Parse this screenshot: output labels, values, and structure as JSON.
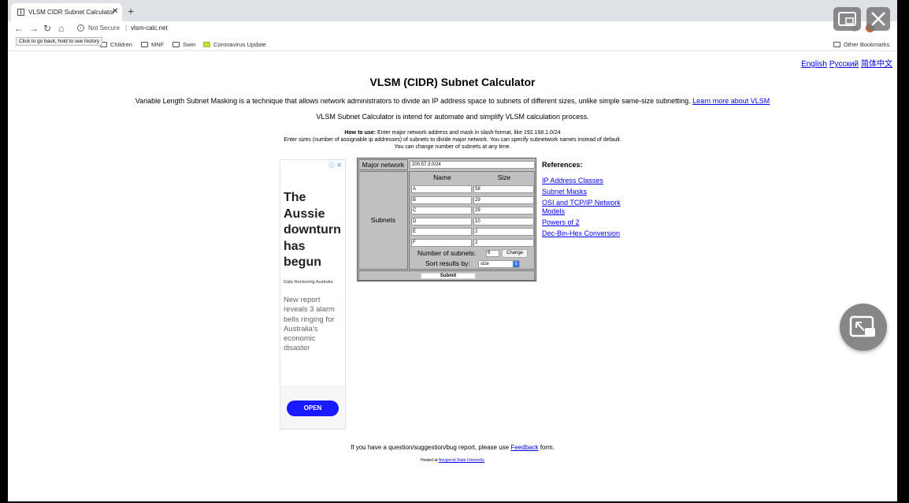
{
  "browser": {
    "tab_title": "VLSM CIDR Subnet Calculator",
    "close_tab": "✕",
    "new_tab": "+",
    "back": "←",
    "forward": "→",
    "reload": "↻",
    "home": "⌂",
    "security_label": "Not Secure",
    "url": "vlsm-calc.net",
    "tooltip": "Click to go back, hold to see history",
    "bookmarks": [
      "Children",
      "MNF",
      "Swin",
      "Coronavirus Update"
    ],
    "other_bookmarks": "Other Bookmarks"
  },
  "page": {
    "languages": [
      "English",
      "Русский",
      "简体中文"
    ],
    "title": "VLSM (CIDR) Subnet Calculator",
    "intro": "Variable Length Subnet Masking is a technique that allows network administrators to divide an IP address space to subnets of different sizes, unlike simple same-size subnetting.",
    "learn_more": "Learn more about VLSM",
    "intro2": "VLSM Subnet Calculator is intend for automate and simplify VLSM calculation process.",
    "how_to_label": "How to use:",
    "how_to_1": "Enter major network address and mask in slash-format, like 192.168.1.0/24",
    "how_to_2": "Enter sizes (number of assignable ip addresses) of subnets to divide major network. You can specify subnetwork names instead of default.",
    "how_to_3": "You can change number of subnets at any time."
  },
  "ad": {
    "choices_icon": "ⓘ ✕",
    "headline": "The Aussie downturn has begun",
    "source": "Daily Reckoning Australia",
    "body": "New report reveals 3 alarm bells ringing for Australia's economic disaster",
    "cta": "OPEN"
  },
  "calculator": {
    "major_network_label": "Major network",
    "major_network_value": "200.57.3.0/24",
    "subnets_label": "Subnets",
    "name_header": "Name",
    "size_header": "Size",
    "subnets": [
      {
        "name": "A",
        "size": "58"
      },
      {
        "name": "B",
        "size": "29"
      },
      {
        "name": "C",
        "size": "29"
      },
      {
        "name": "D",
        "size": "10"
      },
      {
        "name": "E",
        "size": "2"
      },
      {
        "name": "F",
        "size": "2"
      }
    ],
    "num_subnets_label": "Number of subnets:",
    "num_subnets_value": "6",
    "change_label": "Change",
    "sort_label": "Sort results by:",
    "sort_value": "size",
    "submit_label": "Submit"
  },
  "references": {
    "title": "References:",
    "links": [
      "IP Address Classes",
      "Subnet Masks",
      "OSI and TCP/IP Network Models",
      "Powers of 2",
      "Dec-Bin-Hex Conversion"
    ]
  },
  "footer": {
    "text_before": "If you have a question/suggestion/bug report, please use",
    "feedback_link": "Feedback",
    "text_after": "form.",
    "hosted_prefix": "Hosted at",
    "hosted_link": "Novgorod State University"
  },
  "colors": {
    "link": "#0000ee",
    "form_bg": "#c0c0c0",
    "ad_button": "#1a1aff"
  }
}
